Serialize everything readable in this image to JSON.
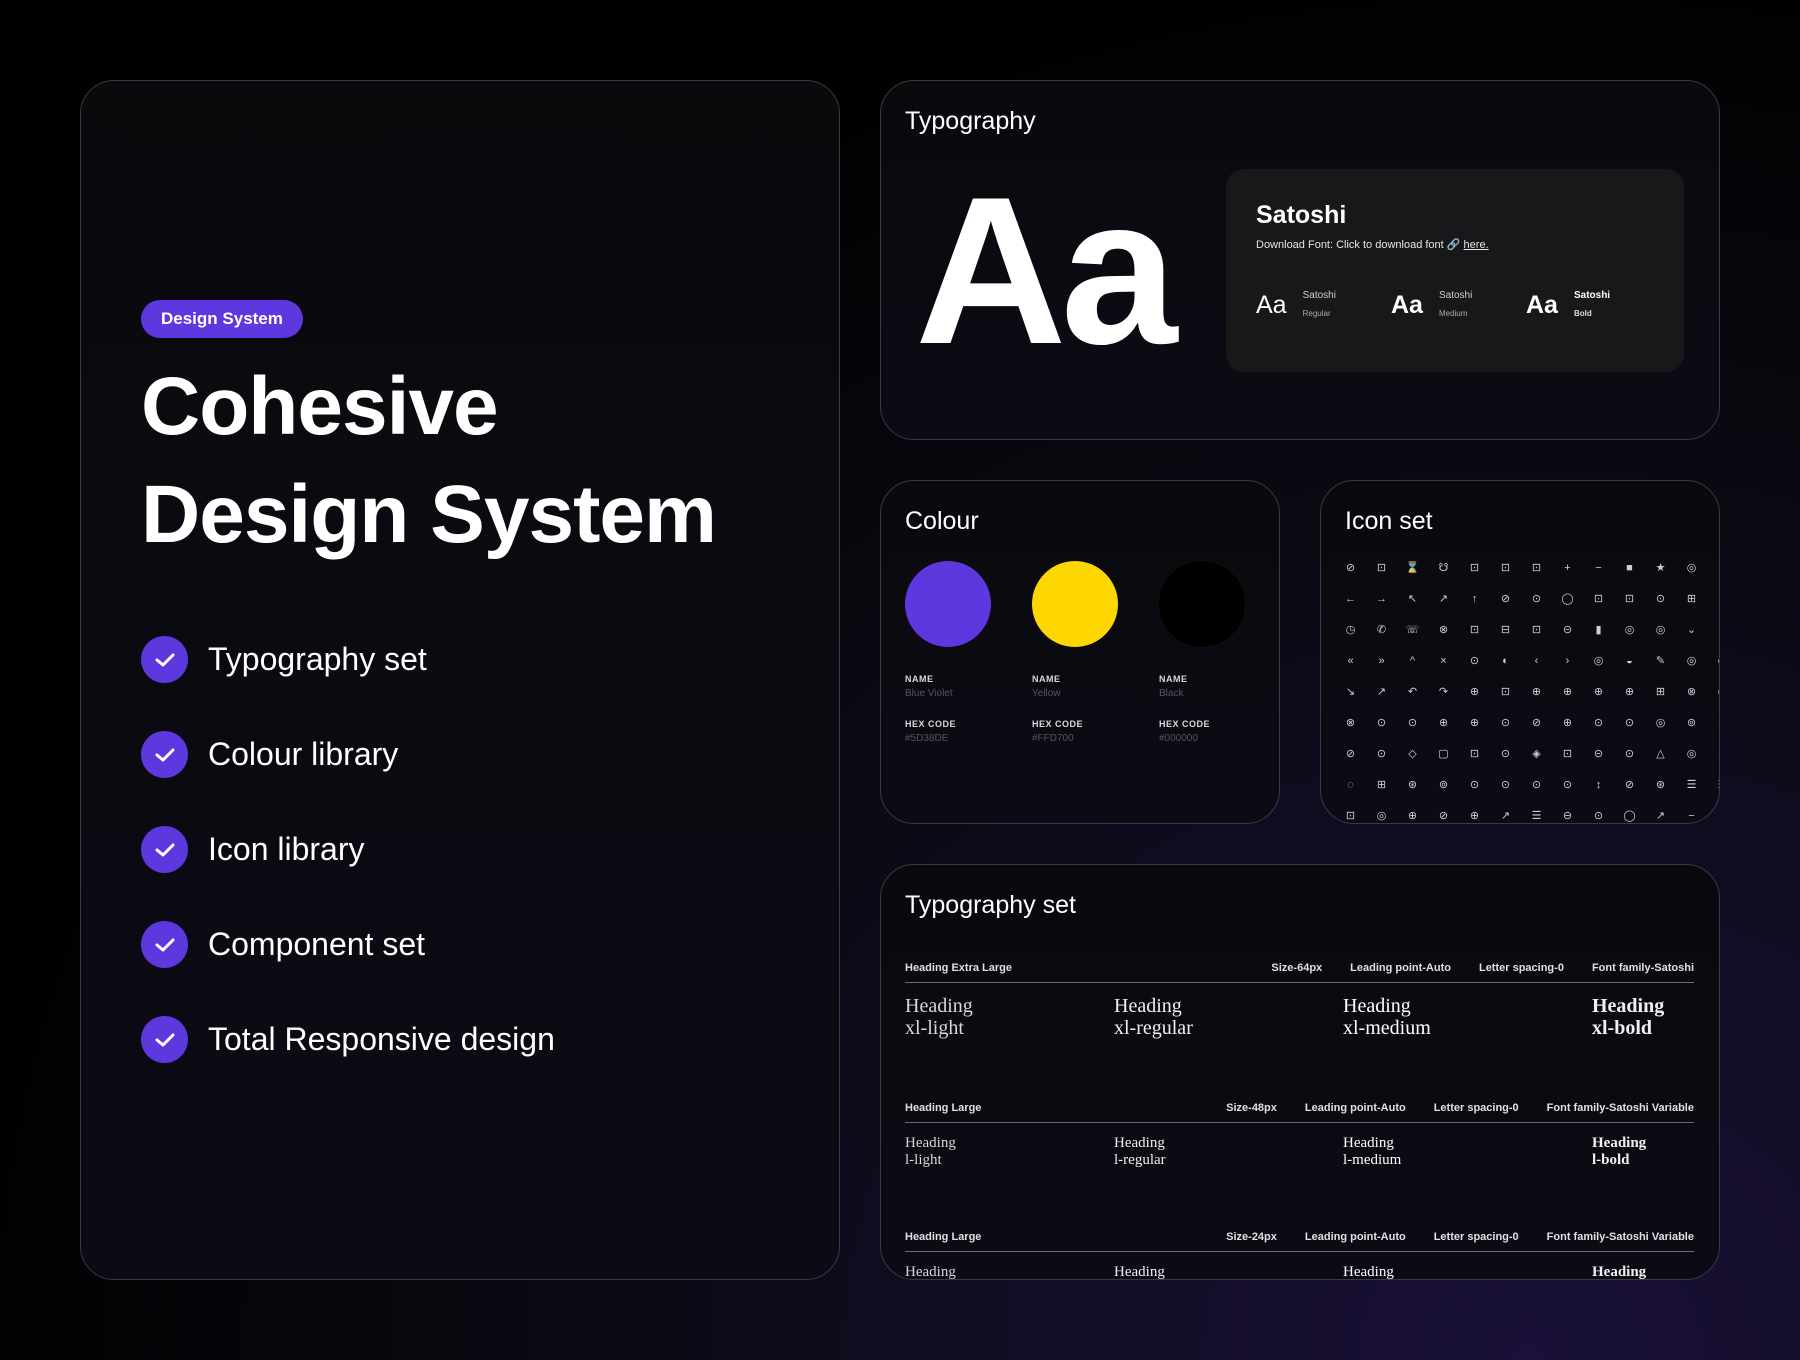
{
  "hero": {
    "badge": "Design System",
    "title_line1": "Cohesive",
    "title_line2": "Design System",
    "features": [
      "Typography set",
      "Colour library",
      "Icon library",
      "Component set",
      "Total Responsive design"
    ]
  },
  "typography": {
    "title": "Typography",
    "sample": "Aa",
    "font_name": "Satoshi",
    "download_text": "Download Font: Click to download font",
    "download_link": "here.",
    "variants": [
      {
        "sample": "Aa",
        "family": "Satoshi",
        "weight": "Regular"
      },
      {
        "sample": "Aa",
        "family": "Satoshi",
        "weight": "Medium"
      },
      {
        "sample": "Aa",
        "family": "Satoshi",
        "weight": "Bold"
      }
    ]
  },
  "colour": {
    "title": "Colour",
    "swatches": [
      {
        "name_label": "NAME",
        "name": "Blue Violet",
        "hex_label": "HEX CODE",
        "hex": "#5D38DE",
        "color": "#5D38DE"
      },
      {
        "name_label": "NAME",
        "name": "Yellow",
        "hex_label": "HEX CODE",
        "hex": "#FFD700",
        "color": "#FFD700"
      },
      {
        "name_label": "NAME",
        "name": "Black",
        "hex_label": "HEX CODE",
        "hex": "#000000",
        "color": "#000000"
      }
    ]
  },
  "icon_set": {
    "title": "Icon set",
    "glyphs": "⊘⊡⌛☋⊡⊡⊡+−■★◎◌←→↖↗↑⊘⊙◯⊡⊡⊙⊞⊙◷✆☏⊗⊡⊟⊡⊝▮◎◎⌄»«»^×⊙◐‹›◎◒✎◎◎↘↗↶↷⊕⊡⊕⊕⊕⊕⊞⊗◎⊗⊙⊙⊕⊕⊙⊘⊕⊙⊙◎⊚⊗⊘⊙◇▢⊡⊙◈⊡⊝⊙△◎⊗◌⊞⊛⊚⊙⊙⊙⊙↕⊘⊛☰☰⊡◎⊕⊘⊕↗☰⊖⊙◯↗−⊝"
  },
  "typography_set": {
    "title": "Typography set",
    "sections": [
      {
        "name": "Heading Extra Large",
        "size": "Size-64px",
        "leading": "Leading point-Auto",
        "spacing": "Letter spacing-0",
        "family": "Font family-Satoshi",
        "samples": [
          "Heading\nxl-light",
          "Heading\nxl-regular",
          "Heading\nxl-medium",
          "Heading\nxl-bold"
        ]
      },
      {
        "name": "Heading Large",
        "size": "Size-48px",
        "leading": "Leading point-Auto",
        "spacing": "Letter spacing-0",
        "family": "Font family-Satoshi Variable",
        "samples": [
          "Heading\nl-light",
          "Heading\nl-regular",
          "Heading\nl-medium",
          "Heading\nl-bold"
        ]
      },
      {
        "name": "Heading Large",
        "size": "Size-24px",
        "leading": "Leading point-Auto",
        "spacing": "Letter spacing-0",
        "family": "Font family-Satoshi Variable",
        "samples": [
          "Heading",
          "Heading",
          "Heading",
          "Heading"
        ]
      }
    ]
  }
}
